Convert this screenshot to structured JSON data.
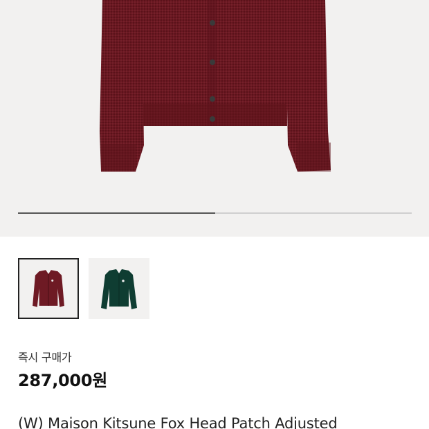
{
  "product": {
    "images": [
      {
        "colorway": "burgundy",
        "color": "#6e1a24",
        "icon": "burgundy-cardigan-thumbnail",
        "selected": true
      },
      {
        "colorway": "dark-green",
        "color": "#0f3d32",
        "icon": "green-cardigan-thumbnail",
        "selected": false
      }
    ],
    "main_image_color": "#6a1821",
    "carousel_progress": 0.5,
    "price_label": "즉시 구매가",
    "price": "287,000원",
    "title": "(W) Maison Kitsune Fox Head Patch Adjusted"
  }
}
